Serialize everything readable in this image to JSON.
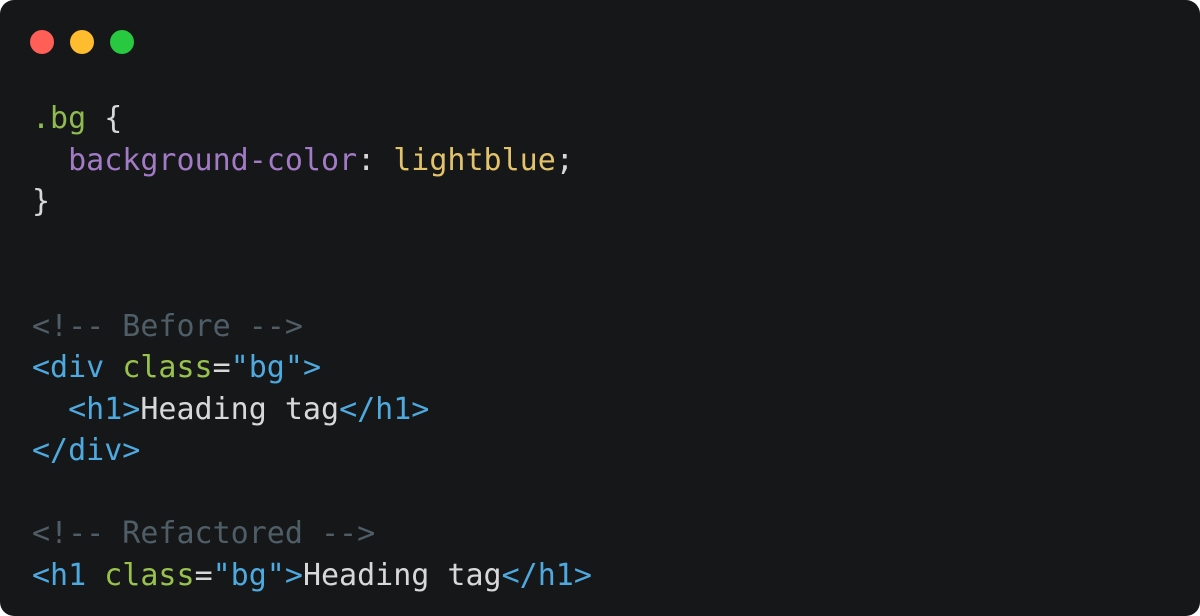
{
  "window": {
    "background": "#151719",
    "controls": [
      {
        "name": "close",
        "color": "#ff5f57"
      },
      {
        "name": "minimize",
        "color": "#febc2e"
      },
      {
        "name": "maximize",
        "color": "#28c840"
      }
    ]
  },
  "code": {
    "line1": {
      "selector": ".bg",
      "brace_open": " {"
    },
    "line2": {
      "indent": "  ",
      "property": "background-color",
      "colon": ": ",
      "value": "lightblue",
      "semicolon": ";"
    },
    "line3": {
      "brace_close": "}"
    },
    "line4": {
      "blank": ""
    },
    "line5": {
      "blank": ""
    },
    "line6": {
      "comment": "<!-- Before -->"
    },
    "line7": {
      "tag_open": "<div",
      "space": " ",
      "attr": "class",
      "eq": "=",
      "string": "\"bg\"",
      "tag_close": ">"
    },
    "line8": {
      "indent": "  ",
      "tag_open": "<h1>",
      "text": "Heading tag",
      "tag_end": "</h1>"
    },
    "line9": {
      "tag_end": "</div>"
    },
    "line10": {
      "blank": ""
    },
    "line11": {
      "comment": "<!-- Refactored -->"
    },
    "line12": {
      "tag_open": "<h1",
      "space": " ",
      "attr": "class",
      "eq": "=",
      "string": "\"bg\"",
      "tag_close": ">",
      "text": "Heading tag",
      "tag_end": "</h1>"
    }
  }
}
